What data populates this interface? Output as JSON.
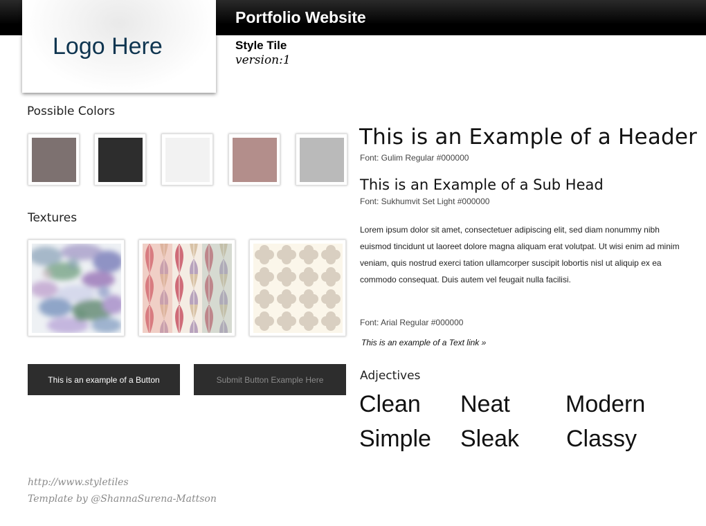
{
  "header": {
    "site_title": "Portfolio Website",
    "logo_text": "Logo Here",
    "tile_label": "Style Tile",
    "version": "version:1"
  },
  "colors": {
    "label": "Possible Colors",
    "swatches": [
      "#7d7170",
      "#2d2d2d",
      "#f2f2f2",
      "#b38e8b",
      "#bababa"
    ]
  },
  "textures": {
    "label": "Textures",
    "items": [
      "watercolor-floral-texture",
      "leaf-pattern-texture",
      "quatrefoil-pattern-texture"
    ]
  },
  "buttons": {
    "primary_label": "This is an example of a Button",
    "submit_label": "Submit Button Example Here"
  },
  "typography": {
    "header_sample": "This is an Example of a Header",
    "header_font": "Font: Gulim Regular #000000",
    "subhead_sample": "This is an Example of a Sub Head",
    "subhead_font": "Font: Sukhumvit Set Light  #000000",
    "body_copy": "Lorem ipsum dolor sit amet, consectetuer adipiscing elit, sed diam nonummy nibh euismod tincidunt ut laoreet dolore magna aliquam erat volutpat. Ut wisi enim ad minim veniam, quis nostrud exerci tation ullamcorper suscipit lobortis nisl ut aliquip ex ea commodo consequat. Duis autem vel feugait nulla facilisi.",
    "body_font": "Font: Arial Regular #000000",
    "link_text": "This is an example of a Text link »"
  },
  "adjectives": {
    "label": "Adjectives",
    "words": [
      "Clean",
      "Neat",
      "Modern",
      "Simple",
      "Sleak",
      "Classy"
    ]
  },
  "footer": {
    "line1": "http://www.styletiles",
    "line2": "Template by @ShannaSurena-Mattson"
  }
}
